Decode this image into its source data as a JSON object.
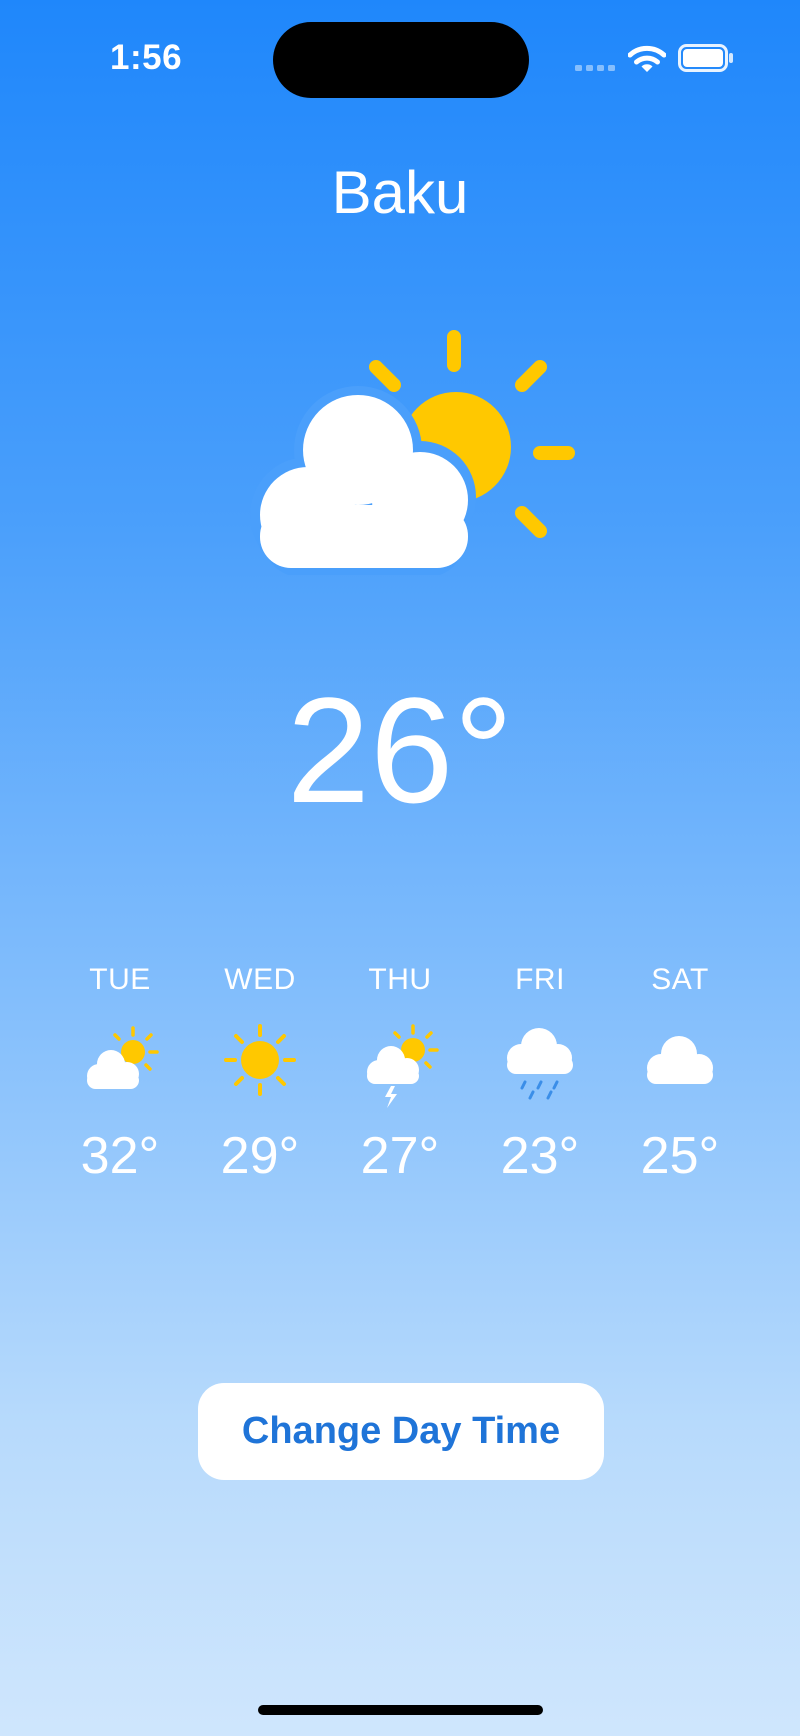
{
  "status_bar": {
    "time": "1:56",
    "icons": [
      "cellular-signal-icon",
      "wifi-icon",
      "battery-icon"
    ]
  },
  "city": "Baku",
  "current": {
    "temperature": "26°",
    "icon": "partly-sunny-cloud-icon"
  },
  "forecast": [
    {
      "day": "TUE",
      "temp": "32°",
      "icon": "partly-cloudy-icon"
    },
    {
      "day": "WED",
      "temp": "29°",
      "icon": "sun-icon"
    },
    {
      "day": "THU",
      "temp": "27°",
      "icon": "thunderstorm-sun-icon"
    },
    {
      "day": "FRI",
      "temp": "23°",
      "icon": "rain-cloud-icon"
    },
    {
      "day": "SAT",
      "temp": "25°",
      "icon": "cloud-icon"
    }
  ],
  "button": {
    "label": "Change Day Time"
  },
  "colors": {
    "sky_top": "#1f87fb",
    "sky_bottom": "#cfe6fd",
    "sun": "#ffc800",
    "cloud": "#ffffff",
    "rain": "#3b8ee8",
    "button_text": "#1f74d8"
  }
}
